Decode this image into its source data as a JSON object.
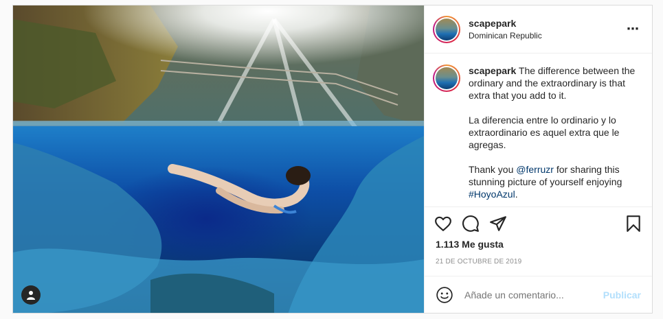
{
  "post": {
    "username": "scapepark",
    "location": "Dominican Republic",
    "more_icon": "⋯",
    "caption": {
      "username": "scapepark",
      "line1": "The difference between the ordinary and the extraordinary is that extra that you add to it.",
      "line2": "La diferencia entre lo ordinario y lo extraordinario es aquel extra que le agregas.",
      "line3_prefix": "Thank you ",
      "mention": "@ferruzr",
      "line3_mid": " for sharing this stunning picture of yourself enjoying ",
      "hashtag": "#HoyoAzul",
      "line3_suffix": "."
    },
    "likes": "1.113 Me gusta",
    "date": "21 DE OCTUBRE DE 2019",
    "comment_placeholder": "Añade un comentario...",
    "publish_label": "Publicar"
  },
  "icons": {
    "like": "heart-icon",
    "comment": "comment-icon",
    "share": "send-icon",
    "save": "bookmark-icon",
    "emoji": "smiley-icon",
    "user_tag": "user-icon"
  },
  "colors": {
    "link": "#00376b",
    "publish_disabled": "#b2dffc",
    "muted": "#8e8e8e"
  }
}
